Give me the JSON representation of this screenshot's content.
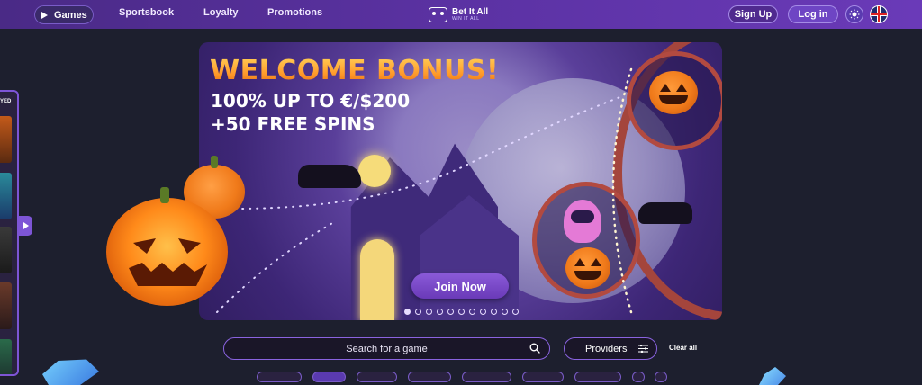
{
  "nav": {
    "games_label": "Games",
    "sportsbook_label": "Sportsbook",
    "loyalty_label": "Loyalty",
    "promotions_label": "Promotions"
  },
  "logo": {
    "name": "Bet It All",
    "tagline": "WIN IT ALL"
  },
  "header_actions": {
    "signup_label": "Sign Up",
    "login_label": "Log in",
    "theme_icon": "sun-icon",
    "language_icon": "uk-flag-icon"
  },
  "sidebar": {
    "title": "YED"
  },
  "banner": {
    "title": "WELCOME BONUS!",
    "line1": "100% UP TO €/$200",
    "line2": "+50 FREE SPINS",
    "cta_label": "Join Now",
    "slide_count": 11,
    "active_slide": 0
  },
  "search": {
    "placeholder": "Search for a game"
  },
  "filters": {
    "providers_label": "Providers",
    "clear_all_label": "Clear all"
  },
  "colors": {
    "accent": "#7d55d6",
    "header_start": "#4a2a86",
    "header_end": "#6a3ab8",
    "background": "#1d1f2e",
    "title_orange": "#ff9a2a"
  }
}
